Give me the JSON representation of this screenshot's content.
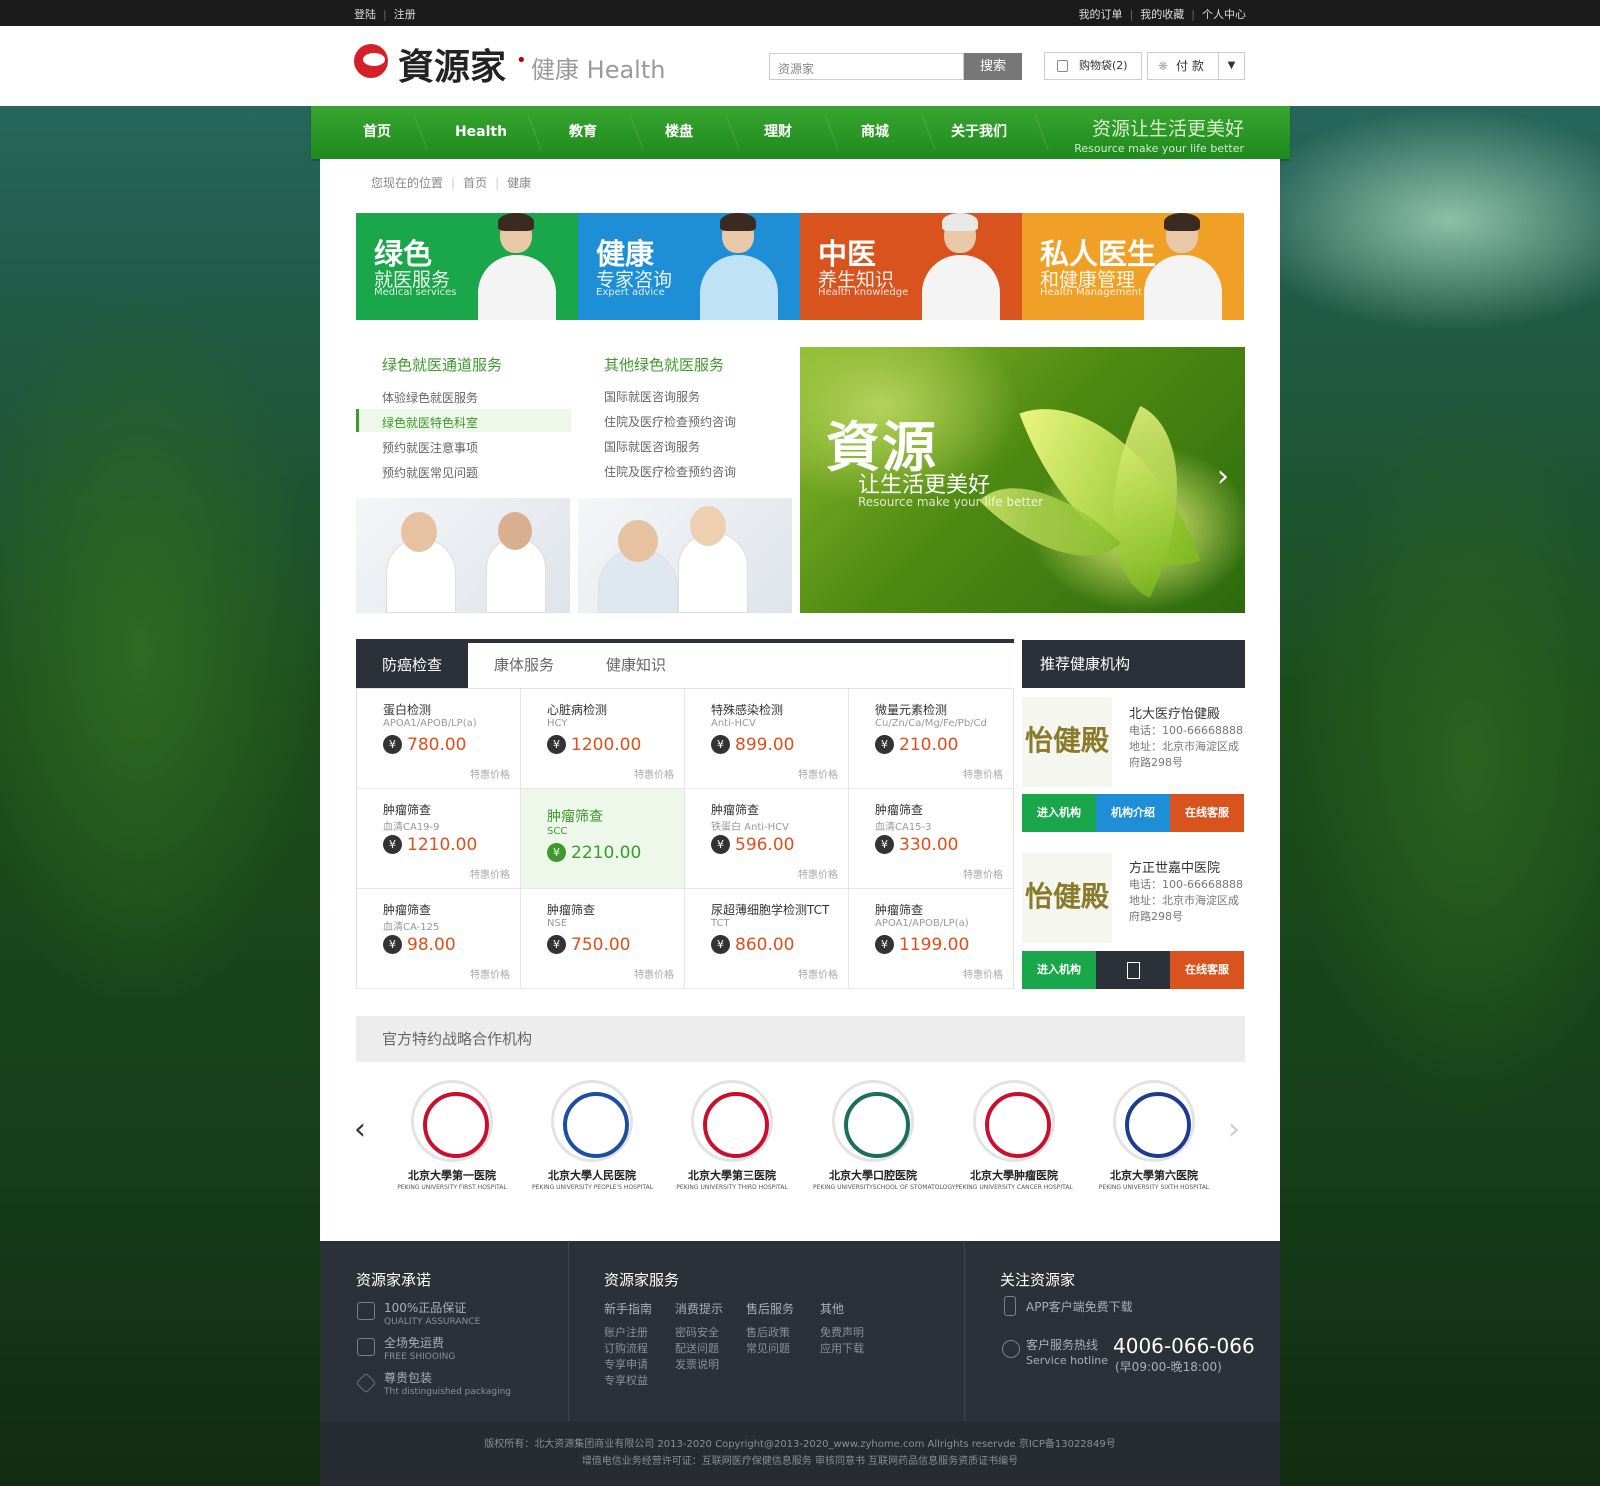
{
  "topbar": {
    "login": "登陆",
    "register": "注册",
    "orders": "我的订单",
    "favorites": "我的收藏",
    "account": "个人中心"
  },
  "header": {
    "brand": "資源家",
    "dot": "•",
    "channel": "健康",
    "channel_en": "Health",
    "search_placeholder": "资源家",
    "search_button": "搜索",
    "cart": "购物袋(2)",
    "pay": "付 款"
  },
  "nav": {
    "items": [
      "首页",
      "Health",
      "教育",
      "楼盘",
      "理财",
      "商城",
      "关于我们"
    ],
    "slogan": "资源让生活更美好",
    "slogan_en": "Resource make your life better"
  },
  "breadcrumb": {
    "label": "您现在的位置",
    "home": "首页",
    "current": "健康"
  },
  "banners": [
    {
      "title": "绿色",
      "subtitle": "就医服务",
      "en": "Medical services",
      "color": "#1aa64a"
    },
    {
      "title": "健康",
      "subtitle": "专家咨询",
      "en": "Expert advice",
      "color": "#1e8fd6"
    },
    {
      "title": "中医",
      "subtitle": "养生知识",
      "en": "Health knowledge",
      "color": "#d9531e"
    },
    {
      "title": "私人医生",
      "subtitle": "和健康管理",
      "en": "Health Management",
      "color": "#f0a026"
    }
  ],
  "services": {
    "col1_title": "绿色就医通道服务",
    "col1": [
      "体验绿色就医服务",
      "绿色就医特色科室",
      "预约就医注意事项",
      "预约就医常见问题"
    ],
    "col2_title": "其他绿色就医服务",
    "col2": [
      "国际就医咨询服务",
      "住院及医疗检查预约咨询",
      "国际就医咨询服务",
      "住院及医疗检查预约咨询"
    ]
  },
  "slide": {
    "title": "資源",
    "subtitle": "让生活更美好",
    "en": "Resource make your life better",
    "next": "›"
  },
  "tabs": [
    "防癌检查",
    "康体服务",
    "健康知识"
  ],
  "products": [
    {
      "name": "蛋白检测",
      "code": "APOA1/APOB/LP(a)",
      "price": "780.00",
      "tag": "特惠价格"
    },
    {
      "name": "心脏病检测",
      "code": "HCY",
      "price": "1200.00",
      "tag": "特惠价格"
    },
    {
      "name": "特殊感染检测",
      "code": "Anti-HCV",
      "price": "899.00",
      "tag": "特惠价格"
    },
    {
      "name": "微量元素检测",
      "code": "Cu/Zn/Ca/Mg/Fe/Pb/Cd",
      "price": "210.00",
      "tag": "特惠价格"
    },
    {
      "name": "肿瘤筛查",
      "code": "血清CA19-9",
      "price": "1210.00",
      "tag": "特惠价格"
    },
    {
      "name": "肿瘤筛查",
      "code": "SCC",
      "price": "2210.00",
      "tag": ""
    },
    {
      "name": "肿瘤筛查",
      "code": "铁蛋白 Anti-HCV",
      "price": "596.00",
      "tag": "特惠价格"
    },
    {
      "name": "肿瘤筛查",
      "code": "血清CA15-3",
      "price": "330.00",
      "tag": "特惠价格"
    },
    {
      "name": "肿瘤筛查",
      "code": "血清CA-125",
      "price": "98.00",
      "tag": "特惠价格"
    },
    {
      "name": "肿瘤筛查",
      "code": "NSE",
      "price": "750.00",
      "tag": "特惠价格"
    },
    {
      "name": "尿超薄细胞学检测TCT",
      "code": "TCT",
      "price": "860.00",
      "tag": "特惠价格"
    },
    {
      "name": "肿瘤筛查",
      "code": "APOA1/APOB/LP(a)",
      "price": "1199.00",
      "tag": "特惠价格"
    }
  ],
  "currency": "¥",
  "recommend": {
    "title": "推荐健康机构",
    "items": [
      {
        "logo": "怡健殿",
        "name": "北大医疗怡健殿",
        "phone": "电话：100-66668888",
        "address": "地址：北京市海淀区成府路298号",
        "btn1": "进入机构",
        "btn2": "机构介绍",
        "btn3": "在线客服"
      },
      {
        "logo": "怡健殿",
        "name": "方正世嘉中医院",
        "phone": "电话：100-66668888",
        "address": "地址：北京市海淀区成府路298号",
        "btn1": "进入机构",
        "btn2": "",
        "btn3": "在线客服"
      }
    ]
  },
  "partners": {
    "title": "官方特约战略合作机构",
    "prev": "‹",
    "next": "›",
    "items": [
      {
        "name": "北京大學第一医院",
        "en": "PEKING UNIVERSITY FIRST HOSPITAL",
        "color": "#c8102e"
      },
      {
        "name": "北京大學人民医院",
        "en": "PEKING UNIVERSITY PEOPLE'S HOSPITAL",
        "color": "#1d4fa0"
      },
      {
        "name": "北京大學第三医院",
        "en": "PEKING UNIVERSITY THIRD HOSPITAL",
        "color": "#c8102e"
      },
      {
        "name": "北京大學口腔医院",
        "en": "PEKING UNIVERSITYSCHOOL OF STOMATOLOGY",
        "color": "#1a6e5a"
      },
      {
        "name": "北京大學肿瘤医院",
        "en": "PEKING UNIVERSITY CANCER HOSPITAL",
        "color": "#c8102e"
      },
      {
        "name": "北京大學第六医院",
        "en": "PEKING UNIVERSITY SIXTH HOSPITAL",
        "color": "#1d3c8f"
      }
    ]
  },
  "footer": {
    "promise_title": "资源家承诺",
    "promises": [
      {
        "cn": "100%正品保证",
        "en": "QUALITY ASSURANCE"
      },
      {
        "cn": "全场免运费",
        "en": "FREE SHIOOING"
      },
      {
        "cn": "尊贵包装",
        "en": "Tht distinguished packaging"
      }
    ],
    "service_title": "资源家服务",
    "service_heads": [
      "新手指南",
      "消费提示",
      "售后服务",
      "其他"
    ],
    "service_links": [
      [
        "账户注册",
        "订购流程",
        "专享申请",
        "专享权益"
      ],
      [
        "密码安全",
        "配送问题",
        "发票说明"
      ],
      [
        "售后政策",
        "常见问题"
      ],
      [
        "免费声明",
        "应用下载"
      ]
    ],
    "follow_title": "关注资源家",
    "app": "APP客户端免费下载",
    "hotline_label": "客户服务热线",
    "hotline_en": "Service hotline",
    "hotline": "4006-066-066",
    "hotline_time": "(早09:00-晚18:00)",
    "copyright": "版权所有：北大资源集团商业有限公司 2013-2020 Copyright@2013-2020_www.zyhome.com  Allrights reservde 京ICP备13022849号",
    "license": "增值电信业务经营许可证：互联网医疗保健信息服务 审核同意书 互联网药品信息服务资质证书编号"
  }
}
